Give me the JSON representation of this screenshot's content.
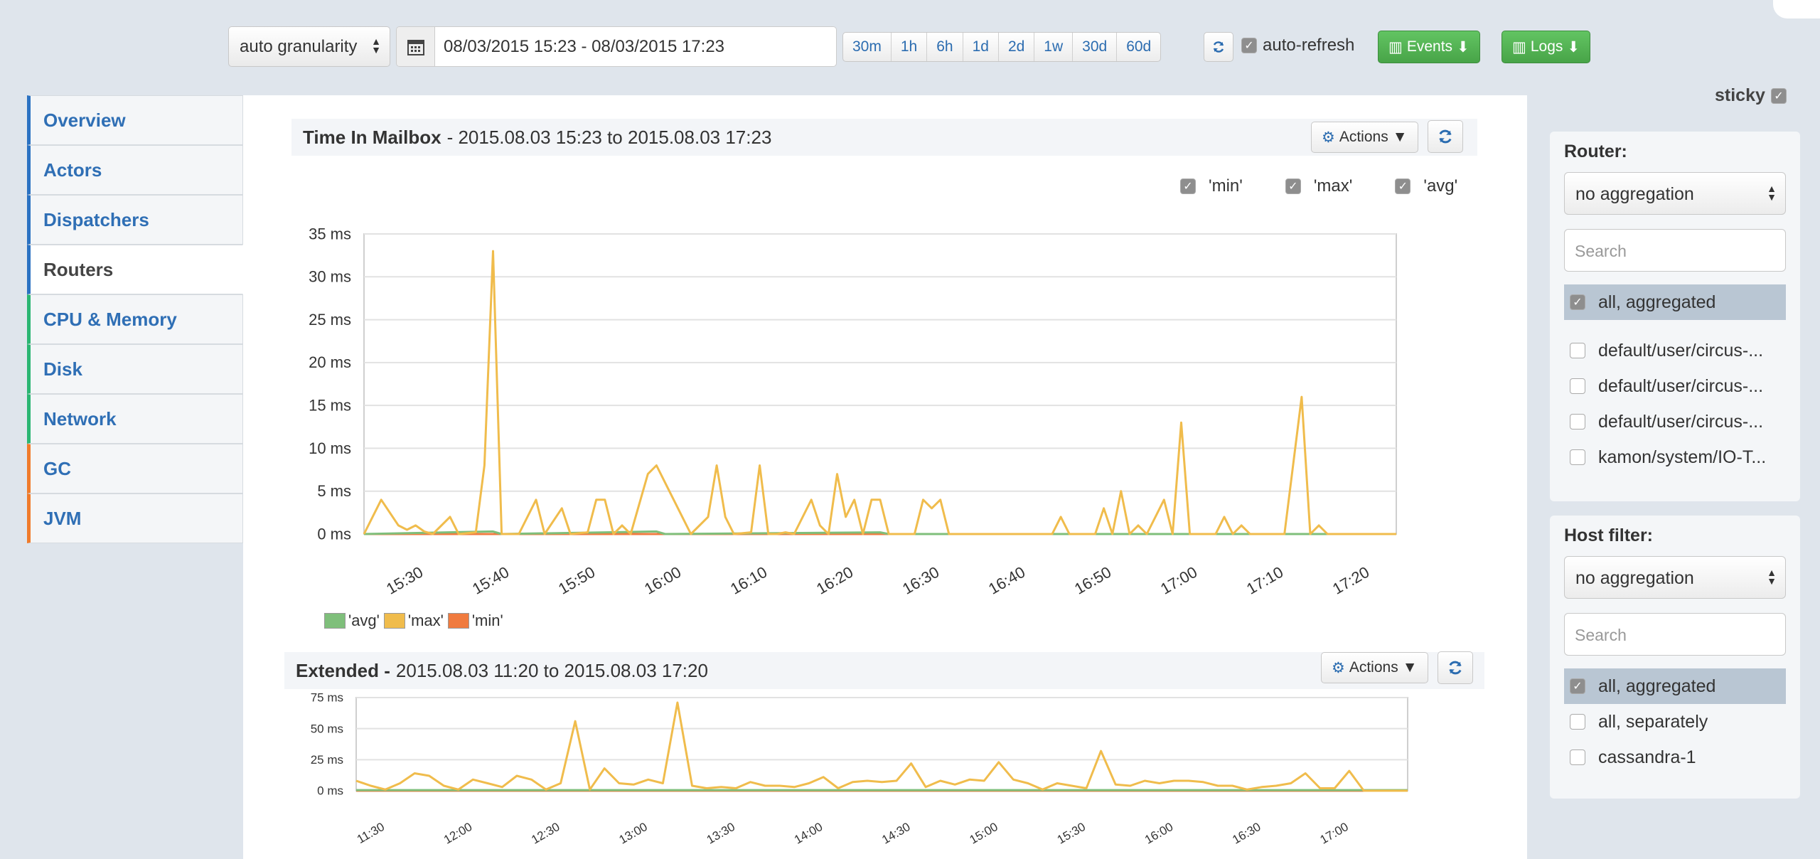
{
  "toolbar": {
    "granularity": "auto granularity",
    "date_range": "08/03/2015 15:23 - 08/03/2015 17:23",
    "ranges": [
      "30m",
      "1h",
      "6h",
      "1d",
      "2d",
      "1w",
      "30d",
      "60d"
    ],
    "auto_refresh_label": "auto-refresh",
    "auto_refresh_checked": true,
    "events_label": "Events",
    "logs_label": "Logs"
  },
  "sidebar": {
    "items": [
      {
        "label": "Overview",
        "accent": "blue",
        "active": false
      },
      {
        "label": "Actors",
        "accent": "blue",
        "active": false
      },
      {
        "label": "Dispatchers",
        "accent": "blue",
        "active": false
      },
      {
        "label": "Routers",
        "accent": "blue",
        "active": true
      },
      {
        "label": "CPU & Memory",
        "accent": "green",
        "active": false
      },
      {
        "label": "Disk",
        "accent": "green",
        "active": false
      },
      {
        "label": "Network",
        "accent": "green",
        "active": false
      },
      {
        "label": "GC",
        "accent": "orange",
        "active": false
      },
      {
        "label": "JVM",
        "accent": "orange",
        "active": false
      }
    ]
  },
  "panel1": {
    "title": "Time In Mailbox",
    "subtitle": "- 2015.08.03 15:23 to 2015.08.03 17:23",
    "actions_label": "Actions",
    "legend_checks": [
      "'min'",
      "'max'",
      "'avg'"
    ]
  },
  "panel2": {
    "title": "Extended -",
    "subtitle": "2015.08.03 11:20 to 2015.08.03 17:20",
    "actions_label": "Actions"
  },
  "bottom_legend": [
    "'avg'",
    "'max'",
    "'min'"
  ],
  "colors": {
    "avg": "#7fbf7b",
    "max": "#f0bc4c",
    "min": "#f07b3f",
    "accent_blue": "#2b72c2"
  },
  "right": {
    "sticky_label": "sticky",
    "router": {
      "label": "Router:",
      "select": "no aggregation",
      "search_placeholder": "Search",
      "options": [
        {
          "label": "all, aggregated",
          "checked": true
        },
        {
          "label": "default/user/circus-...",
          "checked": false
        },
        {
          "label": "default/user/circus-...",
          "checked": false
        },
        {
          "label": "default/user/circus-...",
          "checked": false
        },
        {
          "label": "kamon/system/IO-T...",
          "checked": false
        }
      ]
    },
    "host": {
      "label": "Host filter:",
      "select": "no aggregation",
      "search_placeholder": "Search",
      "options": [
        {
          "label": "all, aggregated",
          "checked": true
        },
        {
          "label": "all, separately",
          "checked": false
        },
        {
          "label": "cassandra-1",
          "checked": false
        }
      ]
    }
  },
  "chart_data": [
    {
      "type": "line",
      "title": "Time In Mailbox",
      "y_tick_labels": [
        "0 ms",
        "5 ms",
        "10 ms",
        "15 ms",
        "20 ms",
        "25 ms",
        "30 ms",
        "35 ms"
      ],
      "x_tick_labels": [
        "15:30",
        "15:40",
        "15:50",
        "16:00",
        "16:10",
        "16:20",
        "16:30",
        "16:40",
        "16:50",
        "17:00",
        "17:10",
        "17:20"
      ],
      "ylim": [
        0,
        35
      ],
      "x_range_minutes": [
        "15:23",
        "17:23"
      ],
      "series": [
        {
          "name": "'max'",
          "color": "#f0bc4c",
          "points": [
            [
              0,
              0
            ],
            [
              2,
              4
            ],
            [
              4,
              1
            ],
            [
              5,
              0.5
            ],
            [
              6,
              1
            ],
            [
              7,
              0.3
            ],
            [
              8,
              0
            ],
            [
              10,
              2
            ],
            [
              11,
              0
            ],
            [
              13,
              0.2
            ],
            [
              14,
              8
            ],
            [
              15,
              33
            ],
            [
              16,
              0
            ],
            [
              18,
              0
            ],
            [
              20,
              4
            ],
            [
              21,
              0
            ],
            [
              23,
              3
            ],
            [
              24,
              0
            ],
            [
              26,
              0.2
            ],
            [
              27,
              4
            ],
            [
              28,
              4
            ],
            [
              29,
              0
            ],
            [
              30,
              1
            ],
            [
              31,
              0
            ],
            [
              33,
              7
            ],
            [
              34,
              8
            ],
            [
              35,
              6
            ],
            [
              36,
              4
            ],
            [
              37,
              2
            ],
            [
              38,
              0
            ],
            [
              40,
              2
            ],
            [
              41,
              8
            ],
            [
              42,
              2
            ],
            [
              43,
              0
            ],
            [
              45,
              0.2
            ],
            [
              46,
              8
            ],
            [
              47,
              0
            ],
            [
              48,
              0
            ],
            [
              49,
              0.2
            ],
            [
              50,
              0
            ],
            [
              52,
              4
            ],
            [
              53,
              1
            ],
            [
              54,
              0
            ],
            [
              55,
              7
            ],
            [
              56,
              2
            ],
            [
              57,
              4
            ],
            [
              58,
              0
            ],
            [
              59,
              4
            ],
            [
              60,
              4
            ],
            [
              61,
              0
            ],
            [
              62,
              0
            ],
            [
              64,
              0
            ],
            [
              65,
              4
            ],
            [
              66,
              3
            ],
            [
              67,
              4
            ],
            [
              68,
              0
            ],
            [
              70,
              0
            ],
            [
              72,
              0
            ],
            [
              74,
              0
            ],
            [
              76,
              0
            ],
            [
              78,
              0
            ],
            [
              80,
              0
            ],
            [
              81,
              2
            ],
            [
              82,
              0
            ],
            [
              84,
              0
            ],
            [
              85,
              0
            ],
            [
              86,
              3
            ],
            [
              87,
              0
            ],
            [
              88,
              5
            ],
            [
              89,
              0
            ],
            [
              90,
              1
            ],
            [
              91,
              0
            ],
            [
              93,
              4
            ],
            [
              94,
              0
            ],
            [
              95,
              13
            ],
            [
              96,
              0
            ],
            [
              98,
              0
            ],
            [
              99,
              0
            ],
            [
              100,
              2
            ],
            [
              101,
              0
            ],
            [
              102,
              1
            ],
            [
              103,
              0
            ],
            [
              105,
              0
            ],
            [
              106,
              0
            ],
            [
              107,
              0
            ],
            [
              109,
              16
            ],
            [
              110,
              0
            ],
            [
              111,
              1
            ],
            [
              112,
              0
            ],
            [
              114,
              0
            ],
            [
              116,
              0
            ],
            [
              118,
              0
            ],
            [
              120,
              0
            ]
          ]
        },
        {
          "name": "'avg'",
          "color": "#7fbf7b",
          "points": [
            [
              0,
              0
            ],
            [
              15,
              0.3
            ],
            [
              16,
              0
            ],
            [
              34,
              0.3
            ],
            [
              35,
              0
            ],
            [
              60,
              0.2
            ],
            [
              61,
              0
            ],
            [
              120,
              0
            ]
          ]
        },
        {
          "name": "'min'",
          "color": "#f07b3f",
          "points": [
            [
              0,
              0
            ],
            [
              120,
              0
            ]
          ]
        }
      ]
    },
    {
      "type": "line",
      "title": "Extended",
      "y_tick_labels": [
        "0 ms",
        "25 ms",
        "50 ms",
        "75 ms"
      ],
      "x_tick_labels": [
        "11:30",
        "12:00",
        "12:30",
        "13:00",
        "13:30",
        "14:00",
        "14:30",
        "15:00",
        "15:30",
        "16:00",
        "16:30",
        "17:00"
      ],
      "ylim": [
        0,
        75
      ],
      "x_range_minutes": [
        "11:20",
        "17:20"
      ],
      "series": [
        {
          "name": "'max'",
          "color": "#f0bc4c",
          "points": [
            [
              0,
              8
            ],
            [
              5,
              4
            ],
            [
              10,
              1
            ],
            [
              15,
              6
            ],
            [
              20,
              14
            ],
            [
              25,
              12
            ],
            [
              30,
              4
            ],
            [
              35,
              1
            ],
            [
              40,
              9
            ],
            [
              45,
              6
            ],
            [
              50,
              3
            ],
            [
              55,
              12
            ],
            [
              60,
              9
            ],
            [
              65,
              1
            ],
            [
              70,
              6
            ],
            [
              75,
              56
            ],
            [
              80,
              1
            ],
            [
              85,
              18
            ],
            [
              90,
              6
            ],
            [
              95,
              5
            ],
            [
              100,
              9
            ],
            [
              105,
              6
            ],
            [
              110,
              71
            ],
            [
              115,
              4
            ],
            [
              120,
              2
            ],
            [
              125,
              3
            ],
            [
              130,
              2
            ],
            [
              135,
              7
            ],
            [
              140,
              4
            ],
            [
              145,
              4
            ],
            [
              150,
              3
            ],
            [
              155,
              6
            ],
            [
              160,
              11
            ],
            [
              165,
              2
            ],
            [
              170,
              7
            ],
            [
              175,
              8
            ],
            [
              180,
              7
            ],
            [
              185,
              8
            ],
            [
              190,
              22
            ],
            [
              195,
              3
            ],
            [
              200,
              8
            ],
            [
              205,
              5
            ],
            [
              210,
              9
            ],
            [
              215,
              8
            ],
            [
              220,
              23
            ],
            [
              225,
              9
            ],
            [
              230,
              6
            ],
            [
              235,
              1
            ],
            [
              240,
              6
            ],
            [
              245,
              4
            ],
            [
              250,
              2
            ],
            [
              255,
              32
            ],
            [
              260,
              5
            ],
            [
              265,
              4
            ],
            [
              270,
              8
            ],
            [
              275,
              6
            ],
            [
              280,
              8
            ],
            [
              285,
              8
            ],
            [
              290,
              7
            ],
            [
              295,
              4
            ],
            [
              300,
              4
            ],
            [
              305,
              1
            ],
            [
              310,
              3
            ],
            [
              315,
              4
            ],
            [
              320,
              6
            ],
            [
              325,
              14
            ],
            [
              330,
              2
            ],
            [
              335,
              2
            ],
            [
              340,
              16
            ],
            [
              345,
              0
            ],
            [
              350,
              0
            ],
            [
              355,
              0
            ],
            [
              360,
              0
            ]
          ]
        },
        {
          "name": "'avg'",
          "color": "#7fbf7b",
          "points": [
            [
              0,
              0.5
            ],
            [
              360,
              0.5
            ]
          ]
        },
        {
          "name": "'min'",
          "color": "#f07b3f",
          "points": [
            [
              0,
              0
            ],
            [
              360,
              0
            ]
          ]
        }
      ]
    }
  ]
}
